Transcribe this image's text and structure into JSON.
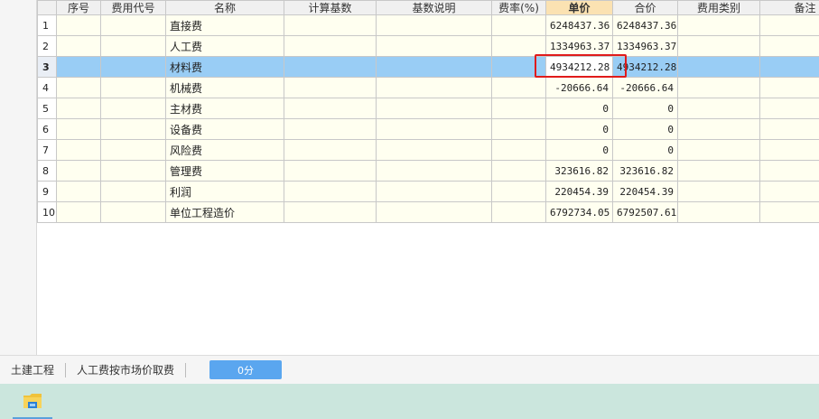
{
  "table": {
    "headers": [
      "序号",
      "费用代号",
      "名称",
      "计算基数",
      "基数说明",
      "费率(%)",
      "单价",
      "合价",
      "费用类别",
      "备注"
    ],
    "active_header_index": 6,
    "rows": [
      {
        "index": "1",
        "name": "直接费",
        "unit_price": "6248437.36",
        "total_price": "6248437.36"
      },
      {
        "index": "2",
        "name": "人工费",
        "unit_price": "1334963.37",
        "total_price": "1334963.37"
      },
      {
        "index": "3",
        "name": "材料费",
        "unit_price": "4934212.28",
        "total_price": "4934212.28"
      },
      {
        "index": "4",
        "name": "机械费",
        "unit_price": "-20666.64",
        "total_price": "-20666.64"
      },
      {
        "index": "5",
        "name": "主材费",
        "unit_price": "0",
        "total_price": "0"
      },
      {
        "index": "6",
        "name": "设备费",
        "unit_price": "0",
        "total_price": "0"
      },
      {
        "index": "7",
        "name": "风险费",
        "unit_price": "0",
        "total_price": "0"
      },
      {
        "index": "8",
        "name": "管理费",
        "unit_price": "323616.82",
        "total_price": "323616.82"
      },
      {
        "index": "9",
        "name": "利润",
        "unit_price": "220454.39",
        "total_price": "220454.39"
      },
      {
        "index": "10",
        "name": "单位工程造价",
        "unit_price": "6792734.05",
        "total_price": "6792507.61"
      }
    ],
    "selected_row_index": 2
  },
  "statusbar": {
    "project": "土建工程",
    "mode": "人工费按市场价取费",
    "score_button": "0分"
  },
  "taskbar": {
    "app_icon": "file-explorer-icon"
  },
  "colors": {
    "selected_row": "#99cdf5",
    "cell_background": "#fffff0",
    "highlight_box": "#e01b1b",
    "status_button": "#5aa6ef",
    "taskbar": "#cbe6dd"
  }
}
